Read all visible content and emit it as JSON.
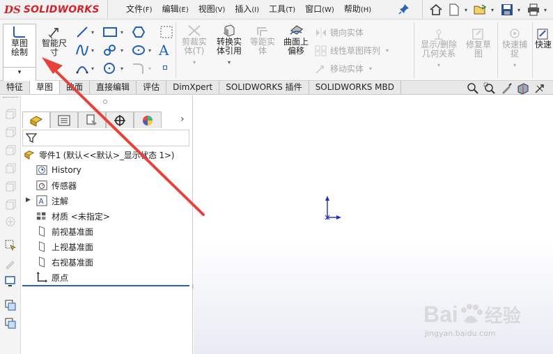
{
  "app": {
    "logo_ds": "DS",
    "logo_name": "SOLIDWORKS"
  },
  "menu": [
    {
      "label": "文件",
      "key": "(F)"
    },
    {
      "label": "编辑",
      "key": "(E)"
    },
    {
      "label": "视图",
      "key": "(V)"
    },
    {
      "label": "插入",
      "key": "(I)"
    },
    {
      "label": "工具",
      "key": "(T)"
    },
    {
      "label": "窗口",
      "key": "(W)"
    },
    {
      "label": "帮助",
      "key": "(H)"
    }
  ],
  "commands": {
    "sketch": "草图绘制",
    "smart_dim": "智能尺寸",
    "trim": "剪裁实体(T)",
    "convert": "转换实体引用",
    "offset": "等距实体",
    "surface_offset": "曲面上偏移",
    "mirror": "镜向实体",
    "linear_pattern": "线性草图阵列",
    "move": "移动实体",
    "show_relations": "显示/删除几何关系",
    "repair": "修复草图",
    "quick_snap": "快速捕捉",
    "quick_view": "快速"
  },
  "tabs": [
    {
      "label": "特征",
      "active": false
    },
    {
      "label": "草图",
      "active": true
    },
    {
      "label": "曲面",
      "active": false
    },
    {
      "label": "直接编辑",
      "active": false
    },
    {
      "label": "评估",
      "active": false
    },
    {
      "label": "DimXpert",
      "active": false
    },
    {
      "label": "SOLIDWORKS 插件",
      "active": false
    },
    {
      "label": "SOLIDWORKS MBD",
      "active": false
    }
  ],
  "tree": {
    "root": "零件1 (默认<<默认>_显示状态 1>)",
    "items": [
      "History",
      "传感器",
      "注解",
      "材质 <未指定>",
      "前视基准面",
      "上视基准面",
      "右视基准面",
      "原点"
    ]
  },
  "watermark": {
    "brand": "Bai",
    "brand_cn": "经验",
    "url": "jingyan.baidu.com"
  },
  "colors": {
    "accent_red": "#d1232a",
    "arrow_red": "#e8413a",
    "origin_blue": "#1a2fb8"
  }
}
